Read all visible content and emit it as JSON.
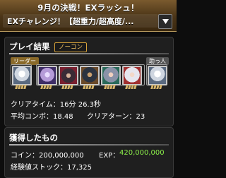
{
  "banner": {
    "line1": "9月の決戦！EXラッシュ！",
    "line2": "EXチャレンジ！【超重力/超高度/..."
  },
  "result": {
    "title": "プレイ結果",
    "badge": "ノーコン",
    "leader_label": "リーダー",
    "helper_label": "助っ人",
    "team": [
      {
        "icon": "white-armored-knight-icon",
        "color": "#cfd6e0"
      },
      {
        "icon": "lilac-winged-creature-icon",
        "color": "#b59bd8"
      },
      {
        "icon": "black-haired-warrior-icon",
        "color": "#3a2b36"
      },
      {
        "icon": "dark-armored-hero-icon",
        "color": "#2b3340"
      },
      {
        "icon": "gray-haired-maiden-icon",
        "color": "#8a92a8"
      },
      {
        "icon": "white-haired-girl-icon",
        "color": "#e6e6ee"
      },
      {
        "icon": "white-armored-knight-icon",
        "color": "#cfd6e0"
      }
    ],
    "clear_time_label": "クリアタイム：16分 26.3秒",
    "avg_combo_label": "平均コンボ：18.48",
    "clear_turns_label": "クリアターン：23"
  },
  "rewards": {
    "title": "獲得したもの",
    "coin_label": "コイン：200,000,000",
    "exp_label": "EXP：",
    "exp_value": "420,000,000",
    "exp_stock_label": "経験値ストック：17,325"
  },
  "colors": {
    "banner_top": "#7a5a2e",
    "badge_border": "#d9a43a",
    "exp_green": "#8cf04a",
    "leader_tag": "#8a6a2a"
  }
}
